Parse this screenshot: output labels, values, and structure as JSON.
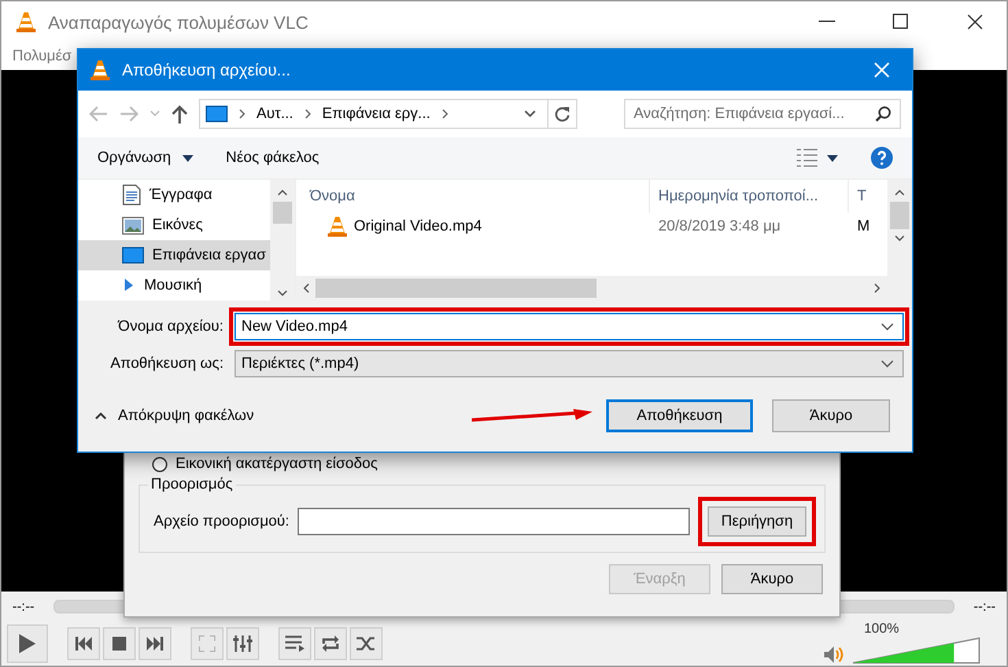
{
  "main_window": {
    "title": "Αναπαραγωγός πολυμέσων VLC",
    "menu": [
      "Πολυμέσ"
    ],
    "player": {
      "elapsed": "--:--",
      "remaining": "--:--",
      "volume": {
        "reading": "100%",
        "level": 0.8
      }
    }
  },
  "convert_dialog": {
    "source_option": {
      "label": "Εικονική ακατέργαστη είσοδος",
      "selected": false
    },
    "destination": {
      "title": "Προορισμός",
      "label": "Αρχείο προορισμού:",
      "browse_button": {
        "label": "Περιήγηση",
        "highlighted": true
      }
    },
    "buttons": [
      {
        "label": "Έναρξη",
        "disabled": true
      },
      {
        "label": "Άκυρο",
        "disabled": false
      }
    ]
  },
  "save_dialog": {
    "title": "Αποθήκευση αρχείου...",
    "breadcrumbs": [
      "Αυτ...",
      "Επιφάνεια εργ..."
    ],
    "search": {
      "placeholder": "Αναζήτηση: Επιφάνεια εργασί..."
    },
    "toolbar": {
      "organize": "Οργάνωση",
      "new_folder": "Νέος φάκελος"
    },
    "nav_items": [
      {
        "label": "Έγγραφα",
        "kind": "documents",
        "selected": false
      },
      {
        "label": "Εικόνες",
        "kind": "pictures",
        "selected": false
      },
      {
        "label": "Επιφάνεια εργασ",
        "kind": "desktop",
        "selected": true
      },
      {
        "label": "Μουσική",
        "kind": "music",
        "selected": false
      }
    ],
    "columns": [
      "Όνομα",
      "Ημερομηνία τροποποί...",
      "Τ"
    ],
    "rows": [
      {
        "name": "Original Video.mp4",
        "date": "20/8/2019 3:48 μμ",
        "column_3": "Μ"
      }
    ],
    "file_name": {
      "label": "Όνομα αρχείου:",
      "value": "New Video.mp4",
      "highlighted": true
    },
    "save_as": {
      "label": "Αποθήκευση ως:",
      "value": "Περιέκτες (*.mp4)"
    },
    "hide_folders": "Απόκρυψη φακέλων",
    "buttons": [
      {
        "label": "Αποθήκευση",
        "default": true,
        "pointed": true
      },
      {
        "label": "Άκυρο",
        "default": false,
        "pointed": false
      }
    ]
  }
}
